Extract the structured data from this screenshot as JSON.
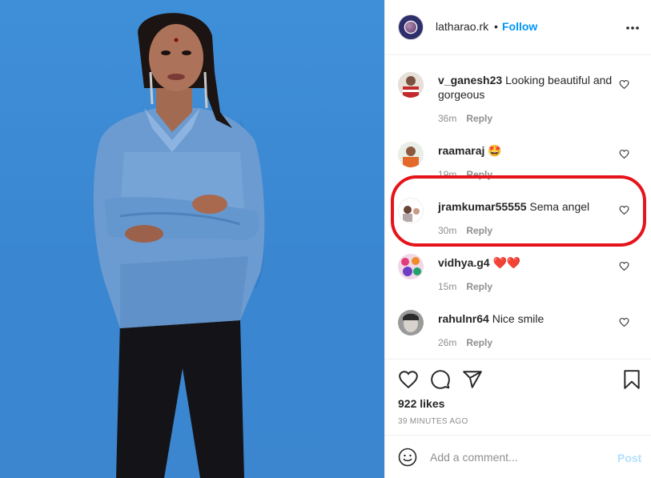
{
  "header": {
    "username": "latharao.rk",
    "separator": "•",
    "follow_label": "Follow"
  },
  "comments": [
    {
      "username": "v_ganesh23",
      "text": "Looking beautiful and gorgeous",
      "time": "36m",
      "reply_label": "Reply"
    },
    {
      "username": "raamaraj",
      "text": "🤩",
      "time": "19m",
      "reply_label": "Reply"
    },
    {
      "username": "jramkumar55555",
      "text": "Sema angel",
      "time": "30m",
      "reply_label": "Reply"
    },
    {
      "username": "vidhya.g4",
      "text": "❤️❤️",
      "time": "15m",
      "reply_label": "Reply"
    },
    {
      "username": "rahulnr64",
      "text": "Nice smile",
      "time": "26m",
      "reply_label": "Reply"
    }
  ],
  "actions": {
    "likes_text": "922 likes",
    "time_ago": "39 MINUTES AGO"
  },
  "add_comment": {
    "placeholder": "Add a comment...",
    "post_label": "Post"
  },
  "colors": {
    "accent": "#0095f6",
    "highlight": "#e5141b",
    "photo_background": "#3b88d3"
  },
  "icons": [
    "more-options-icon",
    "heart-icon",
    "comment-icon",
    "share-icon",
    "bookmark-icon",
    "emoji-icon"
  ]
}
